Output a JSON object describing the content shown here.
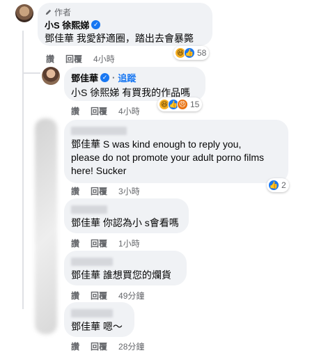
{
  "comments": [
    {
      "author_tag": "作者",
      "name": "小S 徐熙娣",
      "verified": true,
      "text": "鄧佳華 我愛舒適圈，踏出去會暴斃",
      "actions": [
        "讚",
        "回覆"
      ],
      "time": "4小時",
      "reactions": {
        "icons": [
          "haha-icon",
          "like-icon"
        ],
        "count": "58"
      }
    },
    {
      "name": "鄧佳華",
      "verified": true,
      "follow_label": "追蹤",
      "text": "小S 徐熙娣 有買我的作品嗎",
      "actions": [
        "讚",
        "回覆"
      ],
      "time": "4小時",
      "reactions": {
        "icons": [
          "haha-icon",
          "like-icon",
          "angry-icon"
        ],
        "count": "15"
      }
    },
    {
      "name_blurred": true,
      "text": "鄧佳華 S was kind enough to reply you,\nplease do not promote your adult porno films\nhere! Sucker",
      "actions": [
        "讚",
        "回覆"
      ],
      "time": "3小時",
      "reactions": {
        "icons": [
          "like-icon"
        ],
        "count": "2"
      }
    },
    {
      "name_blurred": true,
      "text": "鄧佳華 你認為小 s會看嗎",
      "actions": [
        "讚",
        "回覆"
      ],
      "time": "1小時"
    },
    {
      "name_blurred": true,
      "text": "鄧佳華 誰想買您的爛貨",
      "actions": [
        "讚",
        "回覆"
      ],
      "time": "49分鐘"
    },
    {
      "name_blurred": true,
      "text": "鄧佳華 嗯～",
      "actions": [
        "讚",
        "回覆"
      ],
      "time": "28分鐘"
    }
  ],
  "colors": {
    "bubble": "#f0f2f5",
    "link_blue": "#1877f2",
    "meta_gray": "#65676b",
    "thread_line": "#dfe1e5"
  }
}
